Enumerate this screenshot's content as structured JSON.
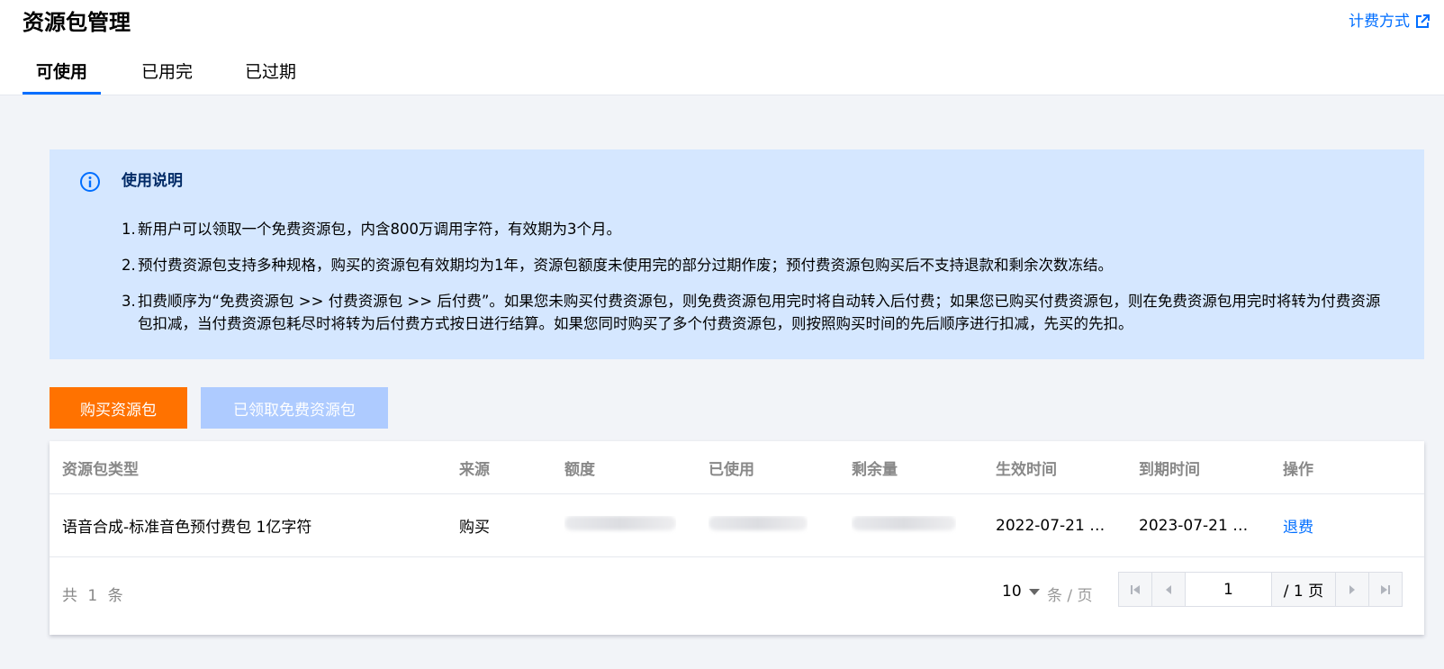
{
  "header": {
    "title": "资源包管理",
    "billing_link": "计费方式"
  },
  "tabs": [
    {
      "label": "可使用",
      "active": true
    },
    {
      "label": "已用完",
      "active": false
    },
    {
      "label": "已过期",
      "active": false
    }
  ],
  "notice": {
    "title": "使用说明",
    "items": [
      {
        "num": "1.",
        "text": "新用户可以领取一个免费资源包，内含800万调用字符，有效期为3个月。"
      },
      {
        "num": "2.",
        "text": "预付费资源包支持多种规格，购买的资源包有效期均为1年，资源包额度未使用完的部分过期作废；预付费资源包购买后不支持退款和剩余次数冻结。"
      },
      {
        "num": "3.",
        "text": "扣费顺序为“免费资源包 >> 付费资源包 >> 后付费”。如果您未购买付费资源包，则免费资源包用完时将自动转入后付费；如果您已购买付费资源包，则在免费资源包用完时将转为付费资源包扣减，当付费资源包耗尽时将转为后付费方式按日进行结算。如果您同时购买了多个付费资源包，则按照购买时间的先后顺序进行扣减，先买的先扣。"
      }
    ]
  },
  "actions": {
    "buy_label": "购买资源包",
    "free_label": "已领取免费资源包"
  },
  "table": {
    "columns": [
      "资源包类型",
      "来源",
      "额度",
      "已使用",
      "剩余量",
      "生效时间",
      "到期时间",
      "操作"
    ],
    "rows": [
      {
        "type": "语音合成-标准音色预付费包 1亿字符",
        "source": "购买",
        "effective": "2022-07-21 1…",
        "expire": "2023-07-21 2…",
        "action": "退费"
      }
    ]
  },
  "pagination": {
    "total_text": "共 1 条",
    "page_size": "10",
    "per_page_label": "条 / 页",
    "current_page": "1",
    "total_pages": "/ 1 页"
  },
  "colors": {
    "accent": "#006eff",
    "buy_button": "#ff7200",
    "disabled_button": "#aecbff",
    "notice_bg": "#d5e7ff"
  }
}
